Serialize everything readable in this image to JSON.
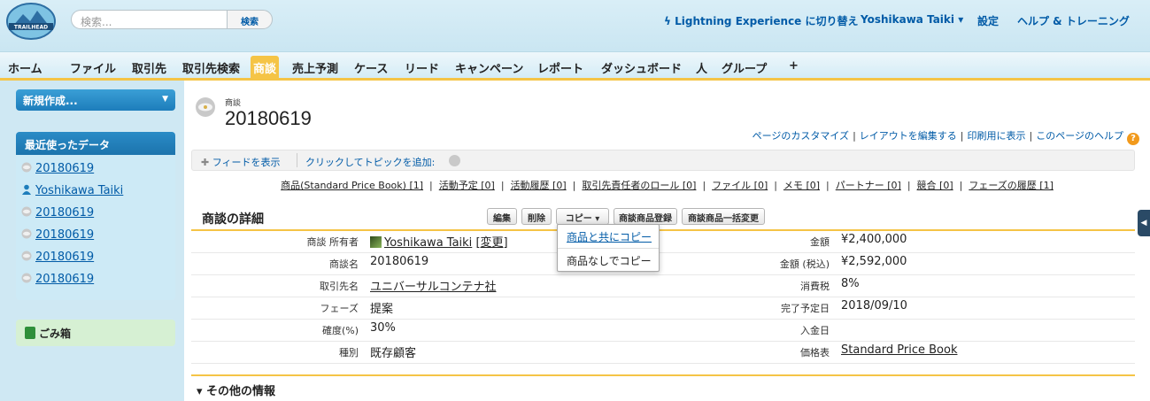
{
  "header": {
    "logo_text": "TRAILHEAD",
    "search_placeholder": "検索...",
    "search_button": "検索",
    "lightning_link": "Lightning Experience に切り替え",
    "user_name": "Yoshikawa Taiki ▾",
    "settings": "設定",
    "help": "ヘルプ & トレーニング"
  },
  "tabs": [
    {
      "label": "ホーム"
    },
    {
      "label": "ファイル"
    },
    {
      "label": "取引先"
    },
    {
      "label": "取引先検索"
    },
    {
      "label": "商談",
      "active": true
    },
    {
      "label": "売上予測"
    },
    {
      "label": "ケース"
    },
    {
      "label": "リード"
    },
    {
      "label": "キャンペーン"
    },
    {
      "label": "レポート"
    },
    {
      "label": "ダッシュボード"
    },
    {
      "label": "人"
    },
    {
      "label": "グループ"
    },
    {
      "label": "+"
    }
  ],
  "sidebar": {
    "new_button": "新規作成...",
    "recent_header": "最近使ったデータ",
    "recent_items": [
      {
        "label": "20180619",
        "icon": "opportunity-icon"
      },
      {
        "label": "Yoshikawa Taiki",
        "icon": "user-icon"
      },
      {
        "label": "20180619",
        "icon": "opportunity-icon"
      },
      {
        "label": "20180619",
        "icon": "opportunity-icon"
      },
      {
        "label": "20180619",
        "icon": "opportunity-icon"
      },
      {
        "label": "20180619",
        "icon": "opportunity-icon"
      }
    ],
    "trash": "ごみ箱"
  },
  "record": {
    "type": "商談",
    "title": "20180619"
  },
  "page_links": {
    "customize": "ページのカスタマイズ",
    "edit_layout": "レイアウトを編集する",
    "print": "印刷用に表示",
    "help": "このページのヘルプ"
  },
  "feed": {
    "show_feed": "フィードを表示",
    "add_topic": "クリックしてトピックを追加:"
  },
  "related_links": [
    "商品(Standard Price Book) [1]",
    "活動予定 [0]",
    "活動履歴 [0]",
    "取引先責任者のロール [0]",
    "ファイル [0]",
    "メモ [0]",
    "パートナー [0]",
    "競合 [0]",
    "フェーズの履歴 [1]"
  ],
  "detail": {
    "title": "商談の詳細",
    "buttons": {
      "edit": "編集",
      "delete": "削除",
      "copy": "コピー ▾",
      "add_products": "商談商品登録",
      "bulk_edit": "商談商品一括変更"
    },
    "left_fields": [
      {
        "label": "商談 所有者",
        "value": "Yoshikawa Taiki",
        "extra": "[変更]"
      },
      {
        "label": "商談名",
        "value": "20180619"
      },
      {
        "label": "取引先名",
        "value": "ユニバーサルコンテナ社"
      },
      {
        "label": "フェーズ",
        "value": "提案"
      },
      {
        "label": "確度(%)",
        "value": "30%"
      },
      {
        "label": "種別",
        "value": "既存顧客"
      }
    ],
    "right_fields": [
      {
        "label": "金額",
        "value": "¥2,400,000"
      },
      {
        "label": "金額 (税込)",
        "value": "¥2,592,000"
      },
      {
        "label": "消費税",
        "value": "8%"
      },
      {
        "label": "完了予定日",
        "value": "2018/09/10"
      },
      {
        "label": "入金日",
        "value": ""
      },
      {
        "label": "価格表",
        "value": "Standard Price Book"
      }
    ]
  },
  "copy_menu": {
    "with_products": "商品と共にコピー",
    "without_products": "商品なしでコピー"
  },
  "other_info": "▾ その他の情報",
  "colors": {
    "accent": "#f5c446",
    "link": "#015ba7",
    "sidebar_header": "#1c74ad"
  }
}
